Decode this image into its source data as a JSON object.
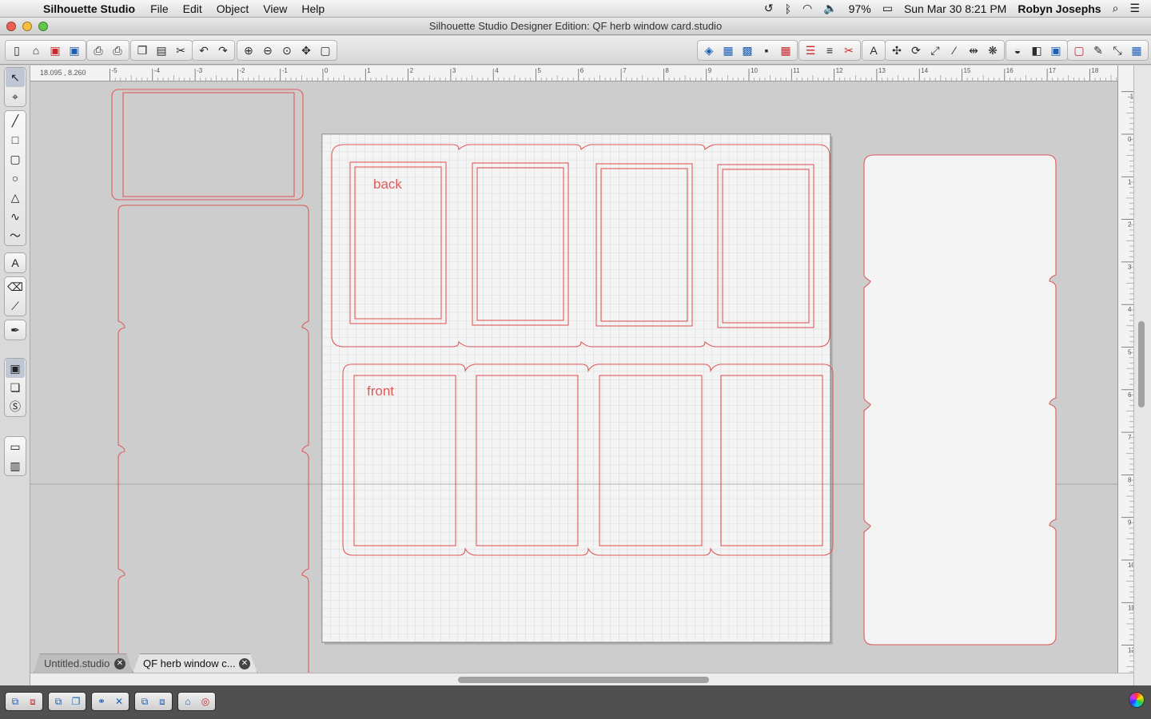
{
  "menubar": {
    "app_name": "Silhouette Studio",
    "menus": [
      "File",
      "Edit",
      "Object",
      "View",
      "Help"
    ],
    "battery": "97%",
    "clock": "Sun Mar 30  8:21 PM",
    "user": "Robyn Josephs"
  },
  "window": {
    "title": "Silhouette Studio Designer Edition: QF herb window card.studio"
  },
  "ruler": {
    "coordinates": "18.095 , 8.260",
    "top_labels": [
      "-5",
      "-4",
      "-3",
      "-2",
      "-1",
      "0",
      "1",
      "2",
      "3",
      "4",
      "5",
      "6",
      "7",
      "8",
      "9",
      "10",
      "11",
      "12",
      "13",
      "14",
      "15",
      "16",
      "17",
      "18"
    ],
    "side_labels": [
      "-1",
      "0",
      "1",
      "2",
      "3",
      "4",
      "5",
      "6",
      "7",
      "8",
      "9",
      "10",
      "11",
      "12"
    ]
  },
  "canvas": {
    "back_label": "back",
    "front_label": "front"
  },
  "tabs": [
    {
      "label": "Untitled.studio",
      "active": false
    },
    {
      "label": "QF herb window c...",
      "active": true
    }
  ],
  "colors": {
    "cut_line": "#e05a5a",
    "grid": "#c4c4c4",
    "mat": "#f4f4f4"
  }
}
